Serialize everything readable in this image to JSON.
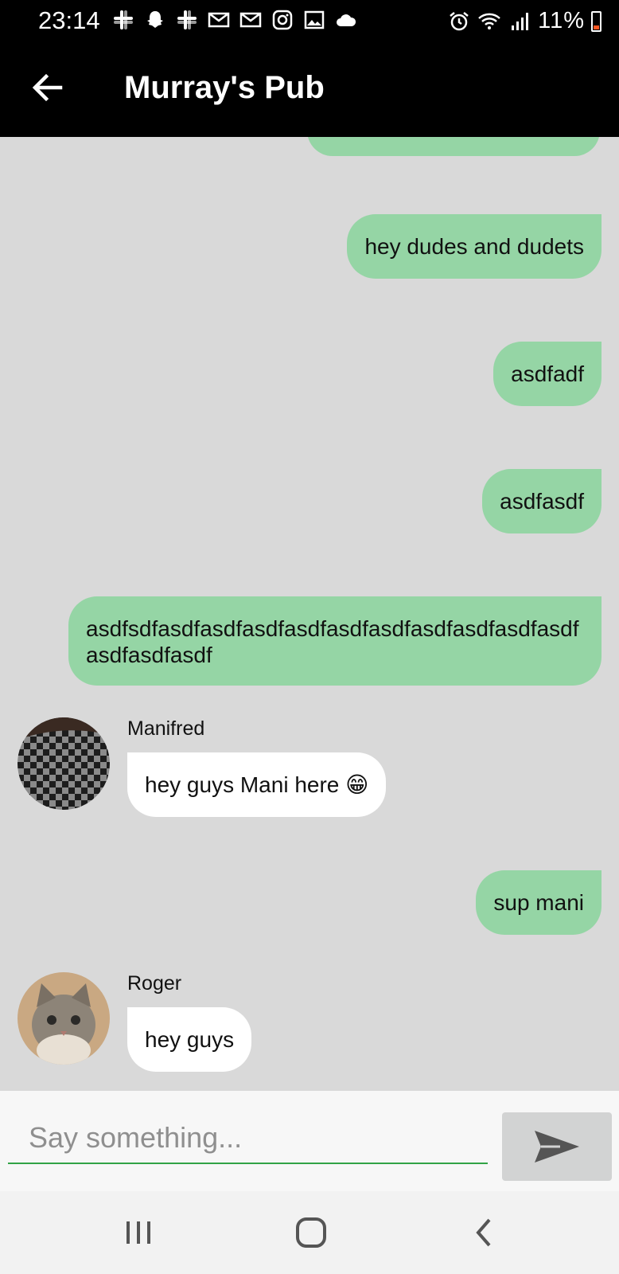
{
  "status_bar": {
    "time": "23:14",
    "battery": "11%",
    "icons_left": [
      "slack-icon",
      "snapchat-icon",
      "slack-icon",
      "gmail-icon",
      "gmail-icon",
      "instagram-icon",
      "gallery-icon",
      "cloud-icon"
    ],
    "icons_right": [
      "alarm-icon",
      "wifi-icon",
      "signal-icon",
      "battery-icon"
    ]
  },
  "app_bar": {
    "title": "Murray's Pub",
    "back_icon": "arrow-left-icon"
  },
  "messages": [
    {
      "type": "outgoing",
      "text": "hey dudes and dudets"
    },
    {
      "type": "outgoing",
      "text": "asdfadf"
    },
    {
      "type": "outgoing",
      "text": "asdfasdf"
    },
    {
      "type": "outgoing",
      "text": "asdfsdfasdfasdfasdfasdfasdfasdfasdfasdfasdfasdfasdfasdfasdf"
    },
    {
      "type": "incoming",
      "sender": "Manifred",
      "text": "hey guys Mani  here 😁",
      "avatar": "checkerboard-avatar"
    },
    {
      "type": "outgoing",
      "text": "sup mani"
    },
    {
      "type": "incoming",
      "sender": "Roger",
      "text": "hey guys",
      "avatar": "kitten-avatar"
    }
  ],
  "composer": {
    "placeholder": "Say something...",
    "send_icon": "send-icon"
  },
  "nav_bar": {
    "icons": [
      "recent-apps-icon",
      "home-icon",
      "back-icon"
    ]
  },
  "colors": {
    "outgoing_bubble": "#95d5a5",
    "incoming_bubble": "#ffffff",
    "chat_background": "#d9d9d9",
    "app_bar": "#000000",
    "input_underline": "#31a346"
  }
}
